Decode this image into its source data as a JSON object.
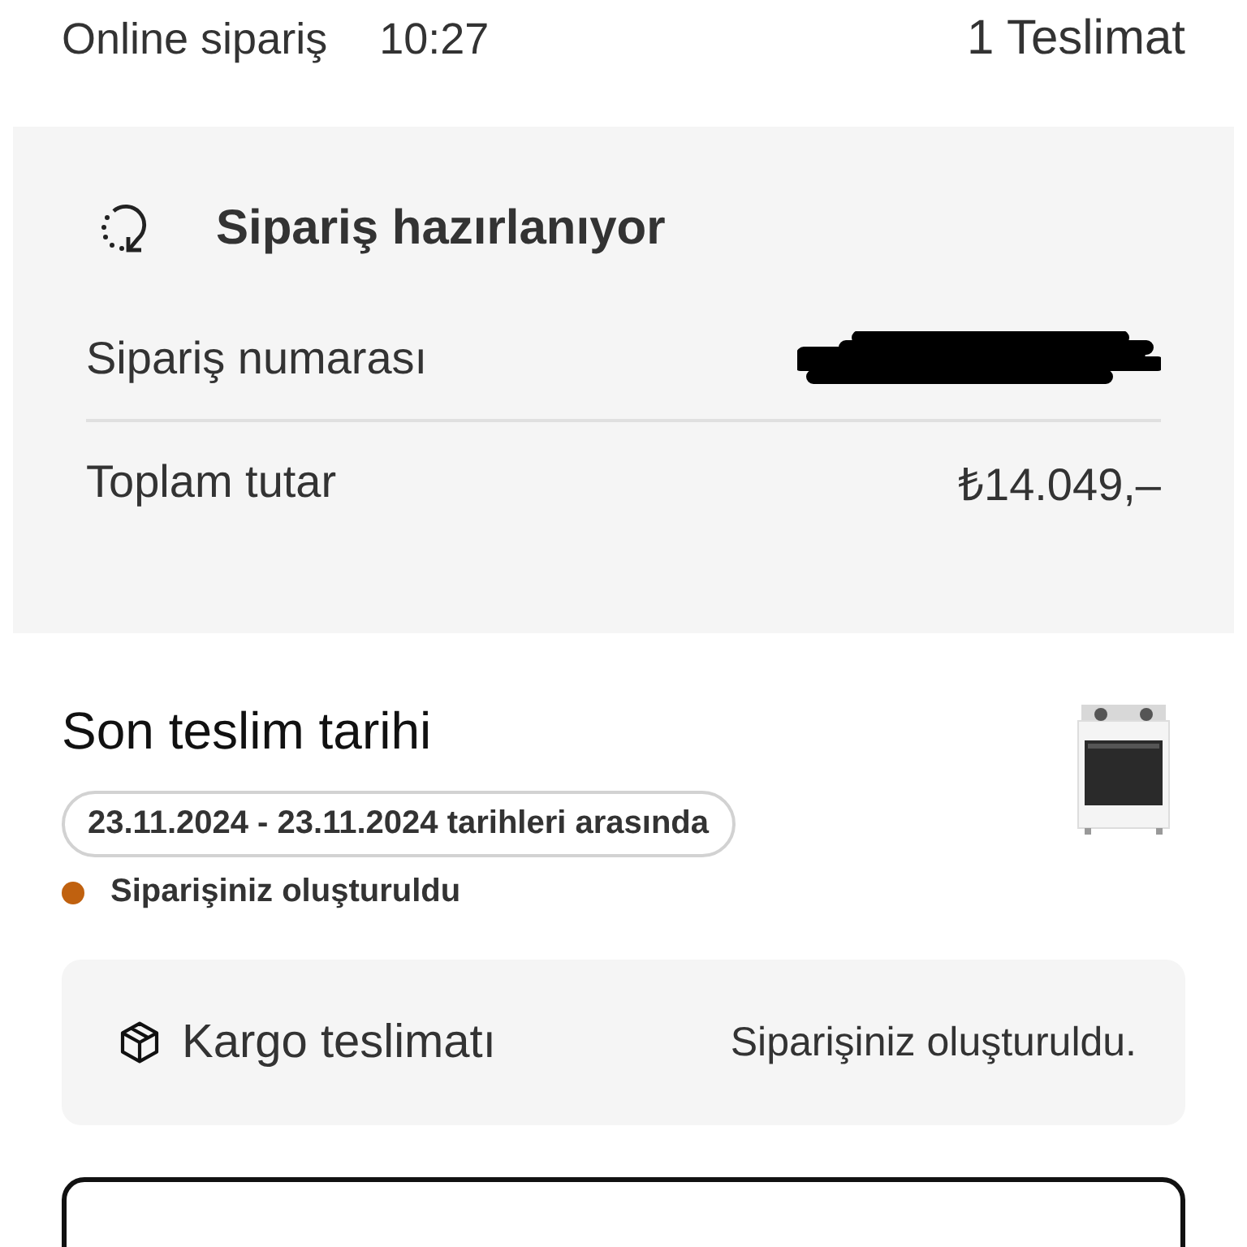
{
  "header": {
    "channel": "Online sipariş",
    "time": "10:27",
    "deliveries": "1 Teslimat"
  },
  "order": {
    "status": "Sipariş hazırlanıyor",
    "rows": [
      {
        "label": "Sipariş numarası",
        "redacted": true
      },
      {
        "label": "Toplam tutar",
        "value": "₺14.049,–",
        "redacted": false
      }
    ]
  },
  "delivery": {
    "title": "Son teslim tarihi",
    "date_range": "23.11.2024 - 23.11.2024 tarihleri arasında",
    "status": {
      "text": "Siparişiniz oluşturuldu",
      "color": "#c0610f"
    },
    "method": {
      "label": "Kargo teslimatı",
      "status": "Siparişiniz oluşturuldu."
    }
  }
}
